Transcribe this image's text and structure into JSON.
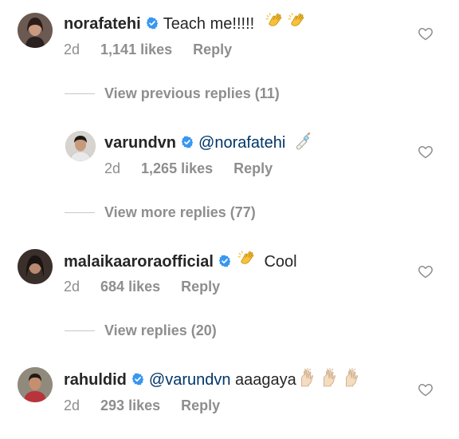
{
  "comments": [
    {
      "username": "norafatehi",
      "text": "Teach me!!!!!",
      "emoji": "clapping-hands",
      "age": "2d",
      "likes": "1,141 likes",
      "reply": "Reply"
    },
    {
      "username": "varundvn",
      "mention": "@norafatehi",
      "emoji": "baby-bottle",
      "age": "2d",
      "likes": "1,265 likes",
      "reply": "Reply"
    },
    {
      "username": "malaikaaroraofficial",
      "text": "Cool",
      "emoji": "clapping-hands",
      "age": "2d",
      "likes": "684 likes",
      "reply": "Reply"
    },
    {
      "username": "rahuldid",
      "mention": "@varundvn",
      "text": "aaagaya",
      "emoji": "raising-hands",
      "age": "2d",
      "likes": "293 likes",
      "reply": "Reply"
    }
  ],
  "view_links": {
    "previous": "View previous replies (11)",
    "more": "View more replies (77)",
    "replies": "View replies (20)"
  },
  "colors": {
    "verified": "#3897f0",
    "meta": "#8e8e8e",
    "mention": "#003569"
  }
}
